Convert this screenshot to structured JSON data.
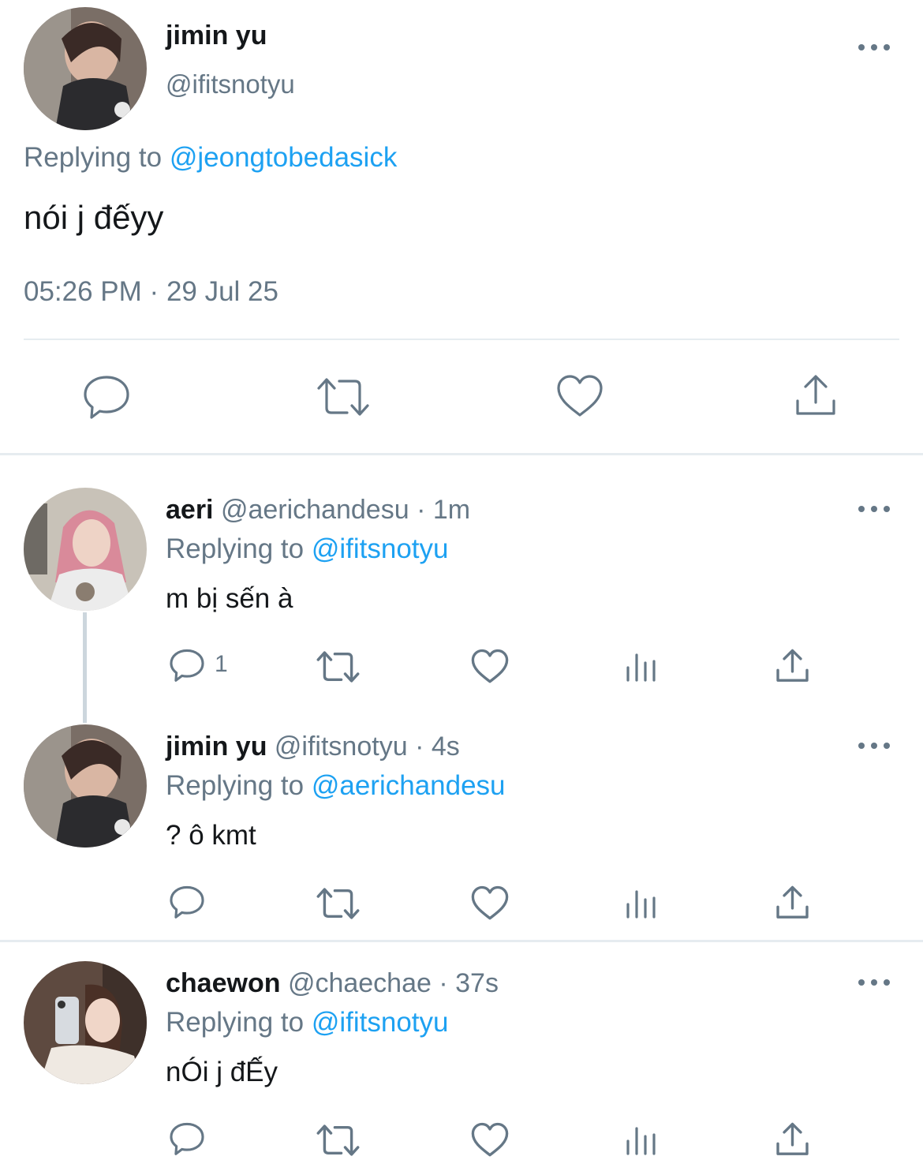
{
  "main_tweet": {
    "display_name": "jimin yu",
    "handle": "@ifitsnotyu",
    "replying_prefix": "Replying to",
    "replying_to": "@jeongtobedasick",
    "text": "nói j đếyy",
    "time": "05:26 PM",
    "separator": "·",
    "date": "29 Jul 25"
  },
  "replies": [
    {
      "display_name": "aeri",
      "handle": "@aerichandesu",
      "age": "· 1m",
      "replying_prefix": "Replying to",
      "replying_to": "@ifitsnotyu",
      "text": "m bị sến à",
      "reply_count": "1"
    },
    {
      "display_name": "jimin yu",
      "handle": "@ifitsnotyu",
      "age": "· 4s",
      "replying_prefix": "Replying to",
      "replying_to": "@aerichandesu",
      "text": "? ô kmt",
      "reply_count": ""
    },
    {
      "display_name": "chaewon",
      "handle": "@chaechae",
      "age": "· 37s",
      "replying_prefix": "Replying to",
      "replying_to": "@ifitsnotyu",
      "text": "nÓi j đẾy",
      "reply_count": ""
    }
  ],
  "colors": {
    "text": "#14171a",
    "secondary": "#657786",
    "link": "#1da1f2",
    "divider": "#e6ecf0"
  },
  "icons": [
    "reply-icon",
    "retweet-icon",
    "like-icon",
    "share-icon",
    "analytics-icon",
    "more-icon"
  ]
}
